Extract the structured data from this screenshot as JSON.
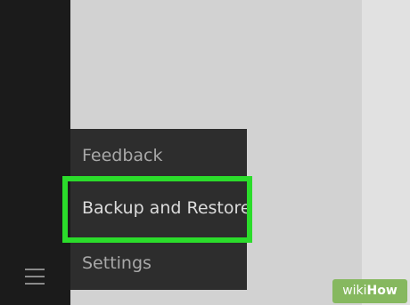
{
  "menu": {
    "items": [
      {
        "label": "Feedback"
      },
      {
        "label": "Backup and Restore",
        "highlighted": true
      },
      {
        "label": "Settings"
      }
    ]
  },
  "sidebar": {
    "menu_icon": "hamburger-icon"
  },
  "watermark": {
    "prefix": "wiki",
    "suffix": "How"
  },
  "colors": {
    "highlight": "#2bdc2b",
    "sidebar": "#1b1b1b",
    "menu_background": "#2d2d2d",
    "content_background": "#d2d2d2"
  }
}
